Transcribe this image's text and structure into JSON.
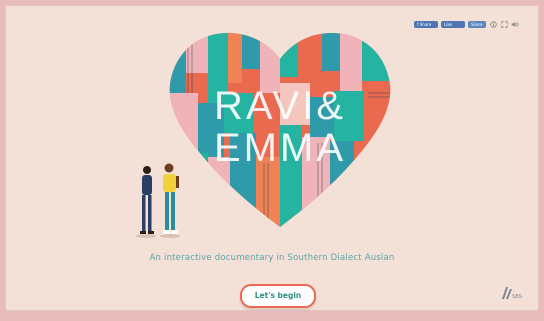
{
  "toolbar": {
    "facebook_label": "f Share",
    "like_label": "Like",
    "share_label": "Share",
    "icons": [
      "info-icon",
      "fullscreen-icon",
      "volume-icon"
    ]
  },
  "hero": {
    "title_line1": "RAVI&",
    "title_line2": "EMMA"
  },
  "tagline": "An interactive documentary in Southern Dialect Auslan",
  "cta_label": "Let's begin",
  "logo": {
    "text": "SBS"
  },
  "colors": {
    "background": "#f3e0d6",
    "outer": "#e8bcbd",
    "accent": "#e96a4f",
    "teal": "#5aa6a9",
    "blue": "#4d76b3"
  }
}
